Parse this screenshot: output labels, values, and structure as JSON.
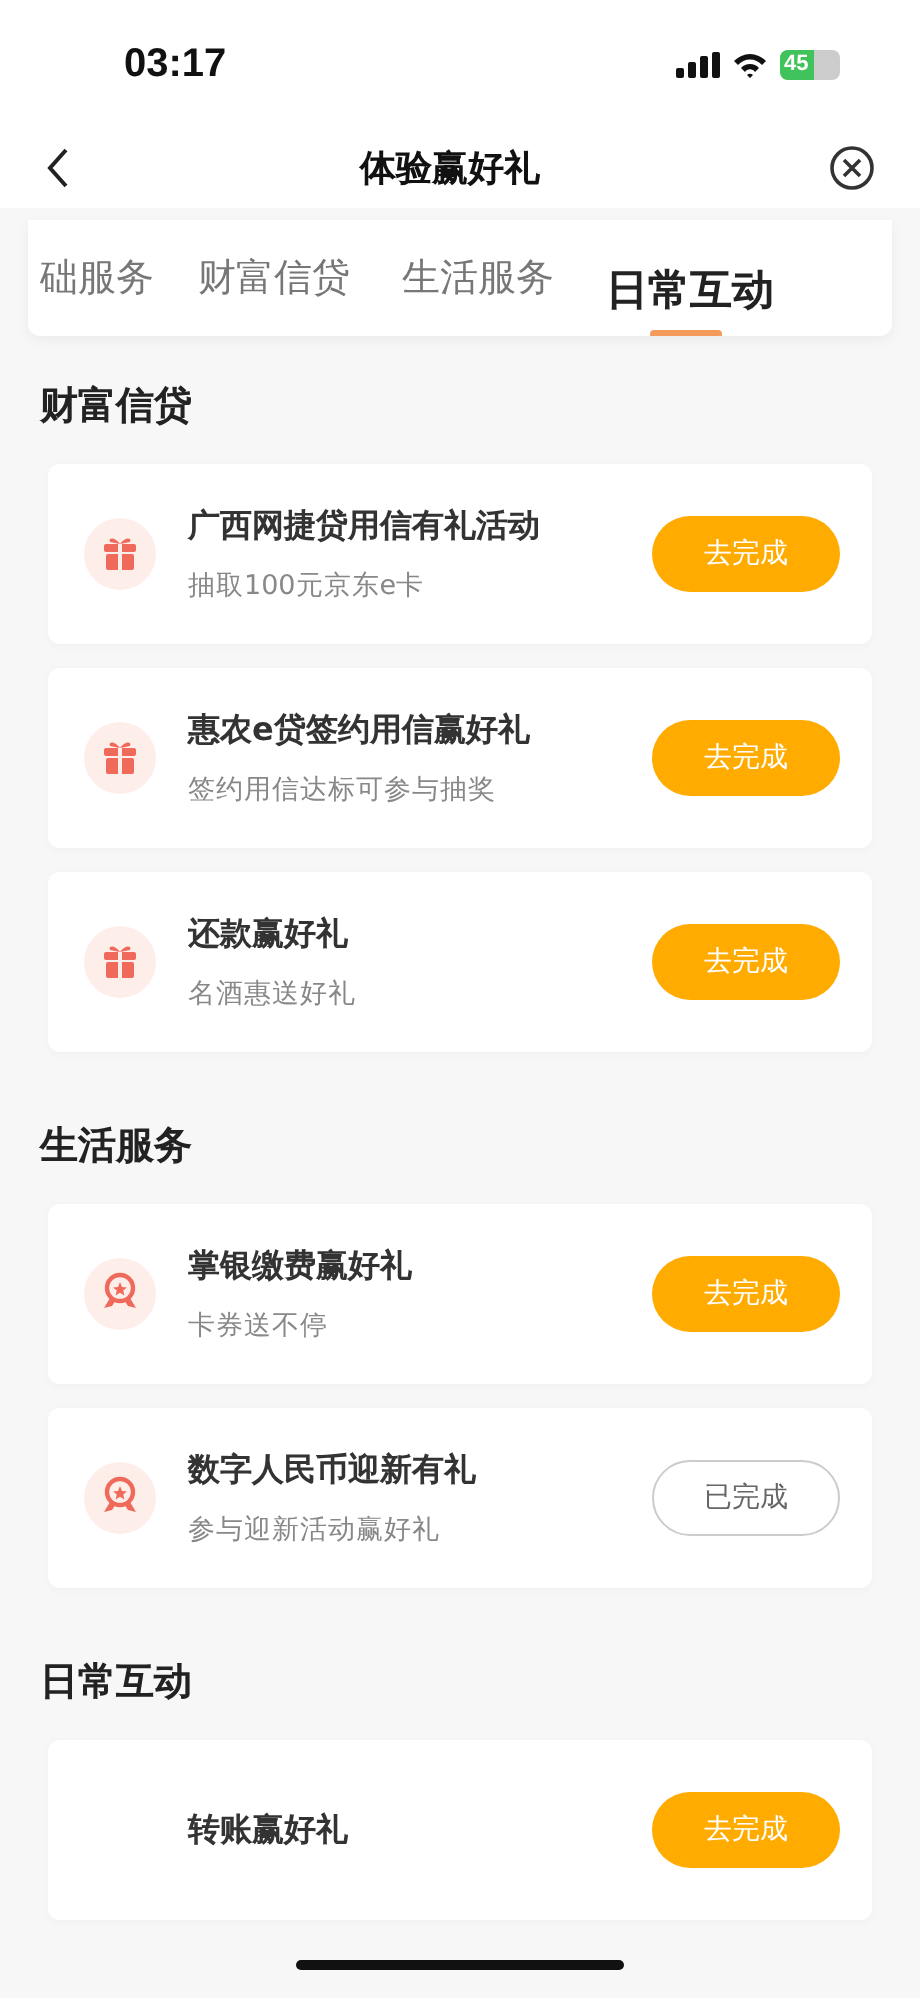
{
  "status_bar": {
    "time": "03:17",
    "battery": "45"
  },
  "nav": {
    "title": "体验赢好礼"
  },
  "tabs": [
    {
      "label": "础服务",
      "selected": false
    },
    {
      "label": "财富信贷",
      "selected": false
    },
    {
      "label": "生活服务",
      "selected": false
    },
    {
      "label": "日常互动",
      "selected": true
    }
  ],
  "sections": [
    {
      "title": "财富信贷",
      "tasks": [
        {
          "kind": "gift",
          "title": "广西网捷贷用信有礼活动",
          "subtitle": "抽取100元京东e卡",
          "button": "去完成",
          "done": false
        },
        {
          "kind": "gift",
          "title": "惠农e贷签约用信赢好礼",
          "subtitle": "签约用信达标可参与抽奖",
          "button": "去完成",
          "done": false
        },
        {
          "kind": "gift",
          "title": "还款赢好礼",
          "subtitle": "名酒惠送好礼",
          "button": "去完成",
          "done": false
        }
      ]
    },
    {
      "title": "生活服务",
      "tasks": [
        {
          "kind": "medal",
          "title": "掌银缴费赢好礼",
          "subtitle": "卡券送不停",
          "button": "去完成",
          "done": false
        },
        {
          "kind": "medal",
          "title": "数字人民币迎新有礼",
          "subtitle": "参与迎新活动赢好礼",
          "button": "已完成",
          "done": true
        }
      ]
    },
    {
      "title": "日常互动",
      "tasks": [
        {
          "title": "转账赢好礼",
          "button": "去完成",
          "done": false
        }
      ]
    }
  ]
}
